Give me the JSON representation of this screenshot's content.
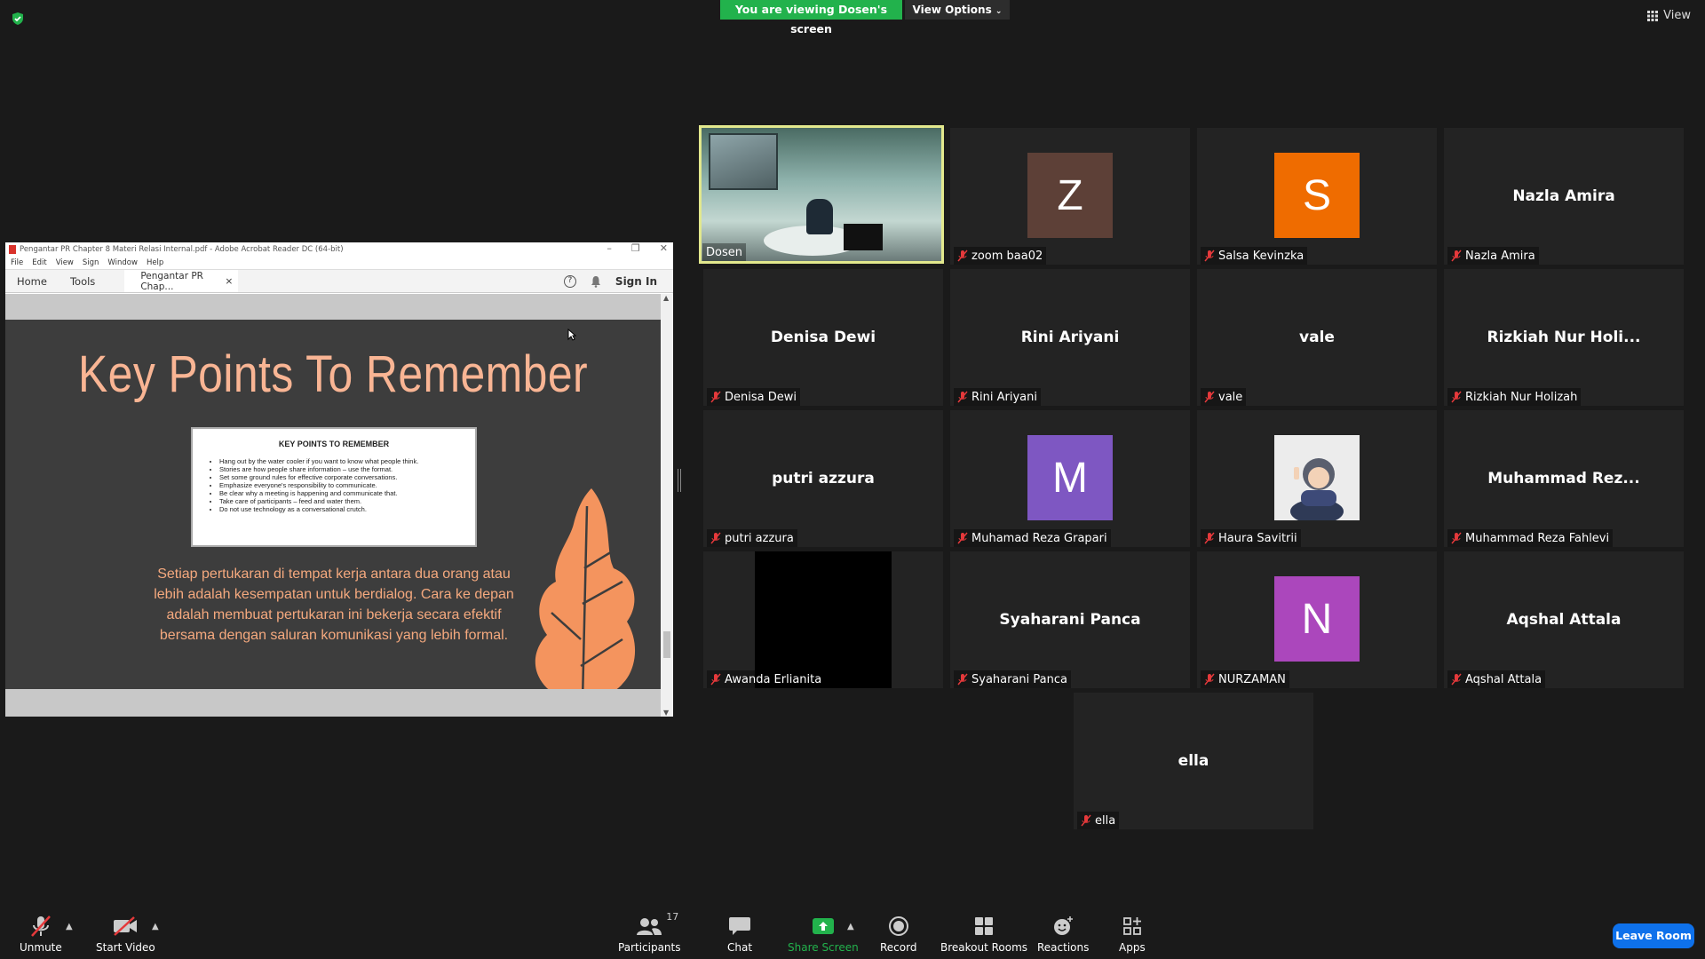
{
  "meeting": {
    "viewing_banner": "You are viewing Dosen's screen",
    "view_options": "View Options",
    "view_label": "View",
    "leave_label": "Leave Room",
    "colors": {
      "banner": "#22b24c",
      "leave": "#0e71eb",
      "share": "#22b24c",
      "active_speaker": "#e2e88d"
    }
  },
  "acrobat": {
    "window_title": "Pengantar PR Chapter 8 Materi Relasi Internal.pdf - Adobe Acrobat Reader DC (64-bit)",
    "menu": [
      "File",
      "Edit",
      "View",
      "Sign",
      "Window",
      "Help"
    ],
    "tab_home": "Home",
    "tab_tools": "Tools",
    "tab_doc": "Pengantar PR Chap...",
    "sign_in": "Sign In"
  },
  "slide": {
    "title": "Key Points To Remember",
    "box_title": "KEY POINTS TO REMEMBER",
    "bullets": [
      "Hang out by the water cooler if you want to know what people think.",
      "Stories are how people share information – use the format.",
      "Set some ground rules for effective corporate conversations.",
      "Emphasize everyone's responsibility to communicate.",
      "Be clear why a meeting is happening and communicate that.",
      "Take care of participants – feed and water them.",
      "Do not use technology as a conversational crutch."
    ],
    "body": "Setiap pertukaran di tempat kerja antara dua orang atau lebih adalah kesempatan untuk berdialog. Cara ke depan adalah membuat pertukaran ini bekerja secara efektif bersama dengan saluran komunikasi yang lebih formal."
  },
  "participants": [
    {
      "label": "Dosen",
      "type": "video",
      "muted": false
    },
    {
      "label": "zoom baa02",
      "type": "avatar",
      "initial": "Z",
      "color": "#5d4037",
      "muted": true
    },
    {
      "label": "Salsa Kevinzka",
      "type": "avatar",
      "initial": "S",
      "color": "#ef6c00",
      "muted": true
    },
    {
      "label": "Nazla Amira",
      "type": "name",
      "display": "Nazla Amira",
      "muted": true
    },
    {
      "label": "Denisa Dewi",
      "type": "name",
      "display": "Denisa Dewi",
      "muted": true
    },
    {
      "label": "Rini Ariyani",
      "type": "name",
      "display": "Rini Ariyani",
      "muted": true
    },
    {
      "label": "vale",
      "type": "name",
      "display": "vale",
      "muted": true
    },
    {
      "label": "Rizkiah Nur Holizah",
      "type": "name",
      "display": "Rizkiah  Nur  Holi...",
      "muted": true
    },
    {
      "label": "putri azzura",
      "type": "name",
      "display": "putri azzura",
      "muted": true
    },
    {
      "label": "Muhamad Reza Grapari",
      "type": "avatar",
      "initial": "M",
      "color": "#7e57c2",
      "muted": true
    },
    {
      "label": "Haura Savitrii",
      "type": "photo",
      "muted": true
    },
    {
      "label": "Muhammad Reza Fahlevi",
      "type": "name",
      "display": "Muhammad  Rez...",
      "muted": true
    },
    {
      "label": "Awanda Erlianita",
      "type": "black",
      "muted": true
    },
    {
      "label": "Syaharani Panca",
      "type": "name",
      "display": "Syaharani Panca",
      "muted": true
    },
    {
      "label": "NURZAMAN",
      "type": "avatar",
      "initial": "N",
      "color": "#ab47bc",
      "muted": true
    },
    {
      "label": "Aqshal Attala",
      "type": "name",
      "display": "Aqshal Attala",
      "muted": true
    },
    {
      "label": "ella",
      "type": "name",
      "display": "ella",
      "muted": true
    }
  ],
  "toolbar": {
    "unmute": "Unmute",
    "start_video": "Start Video",
    "participants": "Participants",
    "participants_count": "17",
    "chat": "Chat",
    "share_screen": "Share Screen",
    "record": "Record",
    "breakout_rooms": "Breakout Rooms",
    "reactions": "Reactions",
    "apps": "Apps"
  }
}
